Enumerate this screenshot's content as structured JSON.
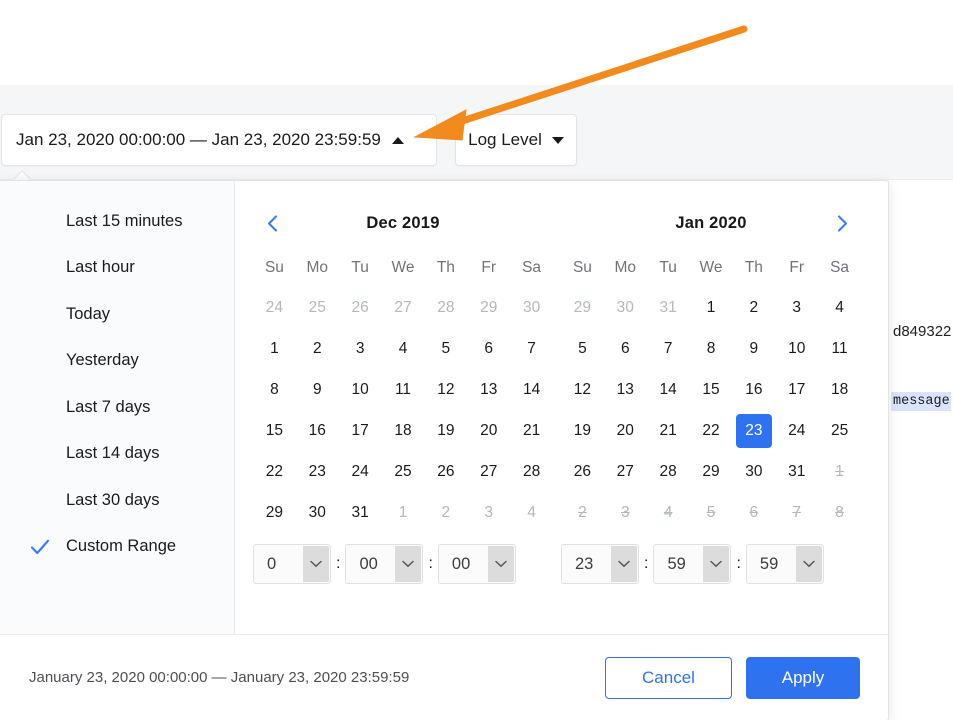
{
  "background": {
    "card_text_fragment": "d849322",
    "highlighted_token": "message"
  },
  "header": {
    "date_range_value": "Jan 23, 2020 00:00:00 — Jan 23, 2020 23:59:59",
    "date_range_caret_icon": "caret-up-icon",
    "log_level_label": "Log Level",
    "log_level_caret_icon": "caret-down-icon"
  },
  "annotation": {
    "arrow_color": "#F28A1E",
    "arrow_icon": "pointer-arrow-icon"
  },
  "presets": {
    "check_icon": "checkmark-icon",
    "items": [
      {
        "label": "Last 15 minutes",
        "selected": false
      },
      {
        "label": "Last hour",
        "selected": false
      },
      {
        "label": "Today",
        "selected": false
      },
      {
        "label": "Yesterday",
        "selected": false
      },
      {
        "label": "Last 7 days",
        "selected": false
      },
      {
        "label": "Last 14 days",
        "selected": false
      },
      {
        "label": "Last 30 days",
        "selected": false
      },
      {
        "label": "Custom Range",
        "selected": true
      }
    ]
  },
  "calendars": {
    "prev_icon": "chevron-left-icon",
    "next_icon": "chevron-right-icon",
    "weekday_headers": [
      "Su",
      "Mo",
      "Tu",
      "We",
      "Th",
      "Fr",
      "Sa"
    ],
    "months": [
      {
        "title": "Dec 2019",
        "show_prev": true,
        "show_next": false,
        "weeks": [
          [
            {
              "d": "24",
              "state": "muted"
            },
            {
              "d": "25",
              "state": "muted"
            },
            {
              "d": "26",
              "state": "muted"
            },
            {
              "d": "27",
              "state": "muted"
            },
            {
              "d": "28",
              "state": "muted"
            },
            {
              "d": "29",
              "state": "muted"
            },
            {
              "d": "30",
              "state": "muted"
            }
          ],
          [
            {
              "d": "1",
              "state": "normal"
            },
            {
              "d": "2",
              "state": "normal"
            },
            {
              "d": "3",
              "state": "normal"
            },
            {
              "d": "4",
              "state": "normal"
            },
            {
              "d": "5",
              "state": "normal"
            },
            {
              "d": "6",
              "state": "normal"
            },
            {
              "d": "7",
              "state": "normal"
            }
          ],
          [
            {
              "d": "8",
              "state": "normal"
            },
            {
              "d": "9",
              "state": "normal"
            },
            {
              "d": "10",
              "state": "normal"
            },
            {
              "d": "11",
              "state": "normal"
            },
            {
              "d": "12",
              "state": "normal"
            },
            {
              "d": "13",
              "state": "normal"
            },
            {
              "d": "14",
              "state": "normal"
            }
          ],
          [
            {
              "d": "15",
              "state": "normal"
            },
            {
              "d": "16",
              "state": "normal"
            },
            {
              "d": "17",
              "state": "normal"
            },
            {
              "d": "18",
              "state": "normal"
            },
            {
              "d": "19",
              "state": "normal"
            },
            {
              "d": "20",
              "state": "normal"
            },
            {
              "d": "21",
              "state": "normal"
            }
          ],
          [
            {
              "d": "22",
              "state": "normal"
            },
            {
              "d": "23",
              "state": "normal"
            },
            {
              "d": "24",
              "state": "normal"
            },
            {
              "d": "25",
              "state": "normal"
            },
            {
              "d": "26",
              "state": "normal"
            },
            {
              "d": "27",
              "state": "normal"
            },
            {
              "d": "28",
              "state": "normal"
            }
          ],
          [
            {
              "d": "29",
              "state": "normal"
            },
            {
              "d": "30",
              "state": "normal"
            },
            {
              "d": "31",
              "state": "normal"
            },
            {
              "d": "1",
              "state": "muted"
            },
            {
              "d": "2",
              "state": "muted"
            },
            {
              "d": "3",
              "state": "muted"
            },
            {
              "d": "4",
              "state": "muted"
            }
          ]
        ]
      },
      {
        "title": "Jan 2020",
        "show_prev": false,
        "show_next": true,
        "weeks": [
          [
            {
              "d": "29",
              "state": "muted"
            },
            {
              "d": "30",
              "state": "muted"
            },
            {
              "d": "31",
              "state": "muted"
            },
            {
              "d": "1",
              "state": "normal"
            },
            {
              "d": "2",
              "state": "normal"
            },
            {
              "d": "3",
              "state": "normal"
            },
            {
              "d": "4",
              "state": "normal"
            }
          ],
          [
            {
              "d": "5",
              "state": "normal"
            },
            {
              "d": "6",
              "state": "normal"
            },
            {
              "d": "7",
              "state": "normal"
            },
            {
              "d": "8",
              "state": "normal"
            },
            {
              "d": "9",
              "state": "normal"
            },
            {
              "d": "10",
              "state": "normal"
            },
            {
              "d": "11",
              "state": "normal"
            }
          ],
          [
            {
              "d": "12",
              "state": "normal"
            },
            {
              "d": "13",
              "state": "normal"
            },
            {
              "d": "14",
              "state": "normal"
            },
            {
              "d": "15",
              "state": "normal"
            },
            {
              "d": "16",
              "state": "normal"
            },
            {
              "d": "17",
              "state": "normal"
            },
            {
              "d": "18",
              "state": "normal"
            }
          ],
          [
            {
              "d": "19",
              "state": "normal"
            },
            {
              "d": "20",
              "state": "normal"
            },
            {
              "d": "21",
              "state": "normal"
            },
            {
              "d": "22",
              "state": "normal"
            },
            {
              "d": "23",
              "state": "selected"
            },
            {
              "d": "24",
              "state": "normal"
            },
            {
              "d": "25",
              "state": "normal"
            }
          ],
          [
            {
              "d": "26",
              "state": "normal"
            },
            {
              "d": "27",
              "state": "normal"
            },
            {
              "d": "28",
              "state": "normal"
            },
            {
              "d": "29",
              "state": "normal"
            },
            {
              "d": "30",
              "state": "normal"
            },
            {
              "d": "31",
              "state": "normal"
            },
            {
              "d": "1",
              "state": "disabled"
            }
          ],
          [
            {
              "d": "2",
              "state": "disabled"
            },
            {
              "d": "3",
              "state": "disabled"
            },
            {
              "d": "4",
              "state": "disabled"
            },
            {
              "d": "5",
              "state": "disabled"
            },
            {
              "d": "6",
              "state": "disabled"
            },
            {
              "d": "7",
              "state": "disabled"
            },
            {
              "d": "8",
              "state": "disabled"
            }
          ]
        ]
      }
    ]
  },
  "time": {
    "separator": ":",
    "chevron_icon": "chevron-down-icon",
    "start": {
      "hour": "0",
      "minute": "00",
      "second": "00"
    },
    "end": {
      "hour": "23",
      "minute": "59",
      "second": "59"
    }
  },
  "footer": {
    "range_summary": "January 23, 2020 00:00:00 — January 23, 2020 23:59:59",
    "cancel_label": "Cancel",
    "apply_label": "Apply"
  },
  "colors": {
    "accent_blue": "#2F72F0",
    "annotation_orange": "#F28A1E",
    "sidebar_bg": "#FAFBFC",
    "toolbar_bg": "#F5F6F8"
  }
}
